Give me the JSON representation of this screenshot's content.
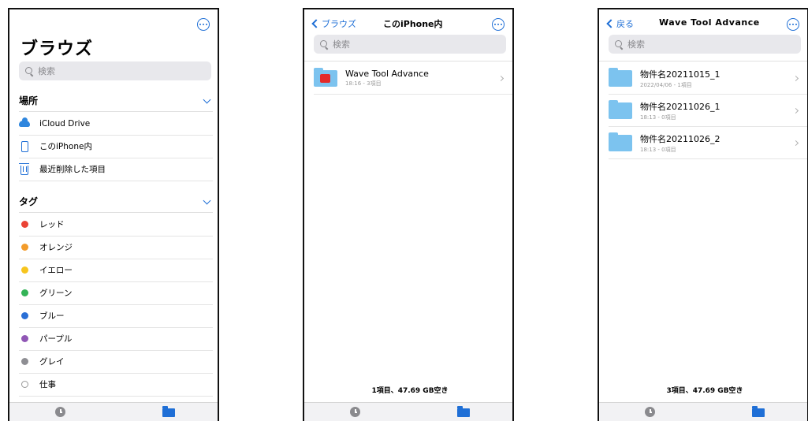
{
  "browse": {
    "title": "ブラウズ",
    "search_placeholder": "検索",
    "locations_header": "場所",
    "locations": [
      {
        "label": "iCloud Drive",
        "icon": "cloud-icon"
      },
      {
        "label": "このiPhone内",
        "icon": "iphone-icon"
      },
      {
        "label": "最近削除した項目",
        "icon": "trash-icon"
      }
    ],
    "tags_header": "タグ",
    "tags": [
      {
        "label": "レッド",
        "color": "#ea4335"
      },
      {
        "label": "オレンジ",
        "color": "#f39c2b"
      },
      {
        "label": "イエロー",
        "color": "#f7c51e"
      },
      {
        "label": "グリーン",
        "color": "#34b457"
      },
      {
        "label": "ブルー",
        "color": "#2a6fd6"
      },
      {
        "label": "パープル",
        "color": "#9057b5"
      },
      {
        "label": "グレイ",
        "color": "#8e8e93"
      },
      {
        "label": "仕事",
        "color": "hollow"
      }
    ]
  },
  "iphone": {
    "back_label": "ブラウズ",
    "title": "このiPhone内",
    "search_placeholder": "検索",
    "items": [
      {
        "name": "Wave Tool Advance",
        "meta": "18:16 - 3項目"
      }
    ],
    "status": "1項目、47.69 GB空き"
  },
  "folder": {
    "back_label": "戻る",
    "title": "Wave Tool Advance",
    "search_placeholder": "検索",
    "items": [
      {
        "name": "物件名20211015_1",
        "meta": "2022/04/06 - 1項目"
      },
      {
        "name": "物件名20211026_1",
        "meta": "18:13 - 0項目"
      },
      {
        "name": "物件名20211026_2",
        "meta": "18:13 - 0項目"
      }
    ],
    "status": "3項目、47.69 GB空き"
  },
  "colors": {
    "accent": "#1f6fd6",
    "folder": "#7cc3ef",
    "app_badge": "#e32a2a"
  }
}
